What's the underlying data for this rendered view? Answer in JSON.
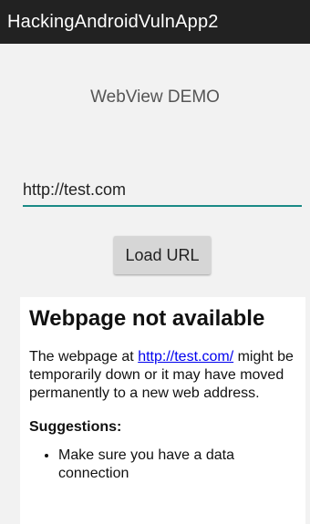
{
  "app_bar": {
    "title": "HackingAndroidVulnApp2"
  },
  "screen": {
    "title": "WebView DEMO",
    "url_input": {
      "value": "http://test.com"
    },
    "load_button": {
      "label": "Load URL"
    }
  },
  "webview": {
    "heading": "Webpage not available",
    "para_prefix": "The webpage at ",
    "link": "http://test.com/",
    "para_suffix": " might be temporarily down or it may have moved permanently to a new web address.",
    "suggestions_label": "Suggestions:",
    "suggestions": [
      "Make sure you have a data connection"
    ]
  },
  "colors": {
    "app_bar_bg": "#222222",
    "input_underline": "#1a8a86",
    "link": "#0000ee"
  }
}
